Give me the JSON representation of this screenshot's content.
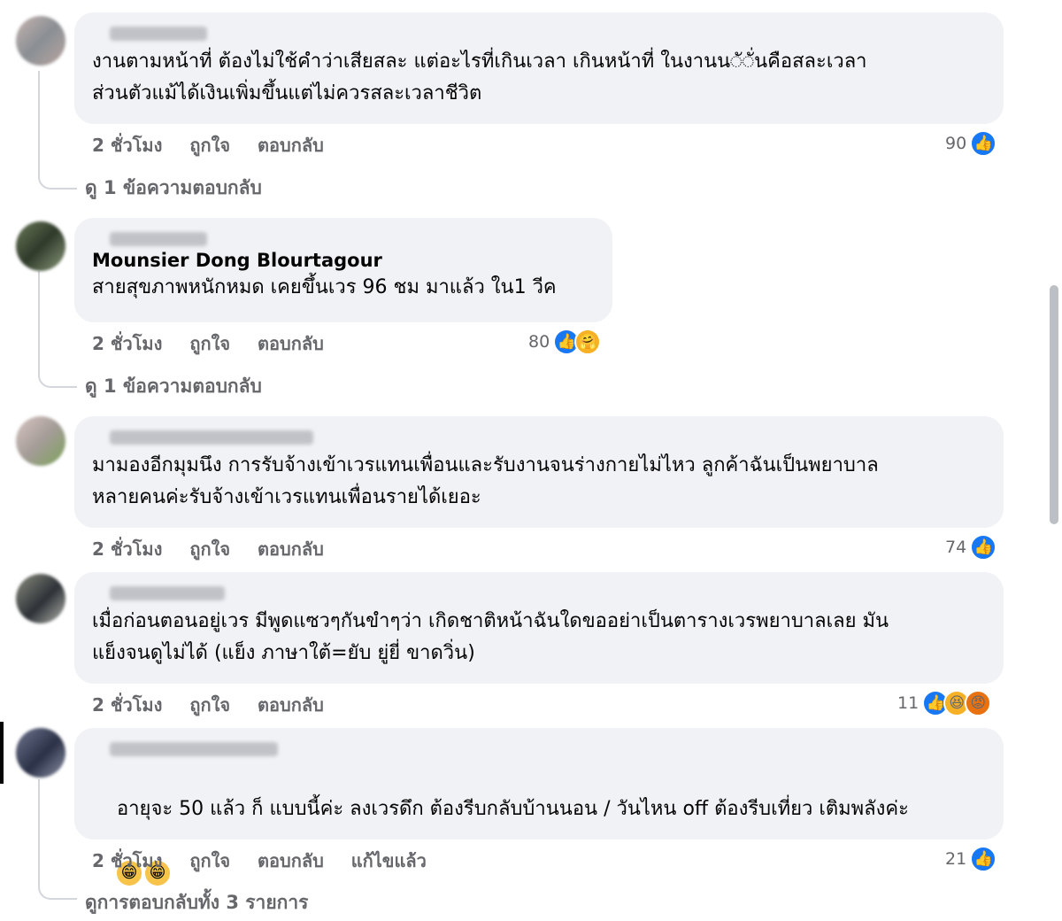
{
  "comments": [
    {
      "text": "งานตามหน้าที่ ต้องไม่ใช้คำว่าเสียสละ แต่อะไรที่เกินเวลา เกินหน้าที่ ในงานน◌ั◌ั่นคือสละเวลา\nส่วนตัวแม้ได้เงินเพิ่มขึ้นแต่ไม่ควรสละเวลาชีวิต",
      "time": "2 ชั่วโมง",
      "like": "ถูกใจ",
      "reply": "ตอบกลับ",
      "reaction_count": "90",
      "replies_link": "ดู 1 ข้อความตอบกลับ"
    },
    {
      "tagged_name": "Mounsier Dong Blourtagour",
      "text": "สายสุขภาพหนักหมด เคยขึ้นเวร 96 ชม มาแล้ว ใน1 วีค",
      "time": "2 ชั่วโมง",
      "like": "ถูกใจ",
      "reply": "ตอบกลับ",
      "reaction_count": "80",
      "replies_link": "ดู 1 ข้อความตอบกลับ"
    },
    {
      "text": "มามองอีกมุมนึง การรับจ้างเข้าเวรแทนเพื่อนและรับงานจนร่างกายไม่ไหว ลูกค้าฉันเป็นพยาบาล\nหลายคนค่ะรับจ้างเข้าเวรแทนเพื่อนรายได้เยอะ",
      "time": "2 ชั่วโมง",
      "like": "ถูกใจ",
      "reply": "ตอบกลับ",
      "reaction_count": "74"
    },
    {
      "text": "เมื่อก่อนตอนอยู่เวร มีพูดแซวๆกันขำๆว่า เกิดชาติหน้าฉันใดขออย่าเป็นตารางเวรพยาบาลเลย มัน\nแย็งจนดูไม่ได้ (แย็ง ภาษาใต้=ยับ ยู่ยี่ ขาดวิ่น)",
      "time": "2 ชั่วโมง",
      "like": "ถูกใจ",
      "reply": "ตอบกลับ",
      "reaction_count": "11"
    },
    {
      "text": "อายุจะ 50 แล้ว ก็ แบบนี้ค่ะ ลงเวรดึก ต้องรีบกลับบ้านนอน / วันไหน off ต้องรีบเที่ยว เติมพลังค่ะ",
      "time": "2 ชั่วโมง",
      "like": "ถูกใจ",
      "reply": "ตอบกลับ",
      "edited": "แก้ไขแล้ว",
      "reaction_count": "21",
      "replies_link": "ดูการตอบกลับทั้ง 3 รายการ"
    }
  ],
  "icons": {
    "like": "like-icon",
    "haha": "haha-icon",
    "angry": "angry-icon",
    "care": "care-icon"
  },
  "colors": {
    "bubble": "#f0f2f5",
    "like_blue": "#1877f2",
    "meta_gray": "#65676b"
  }
}
